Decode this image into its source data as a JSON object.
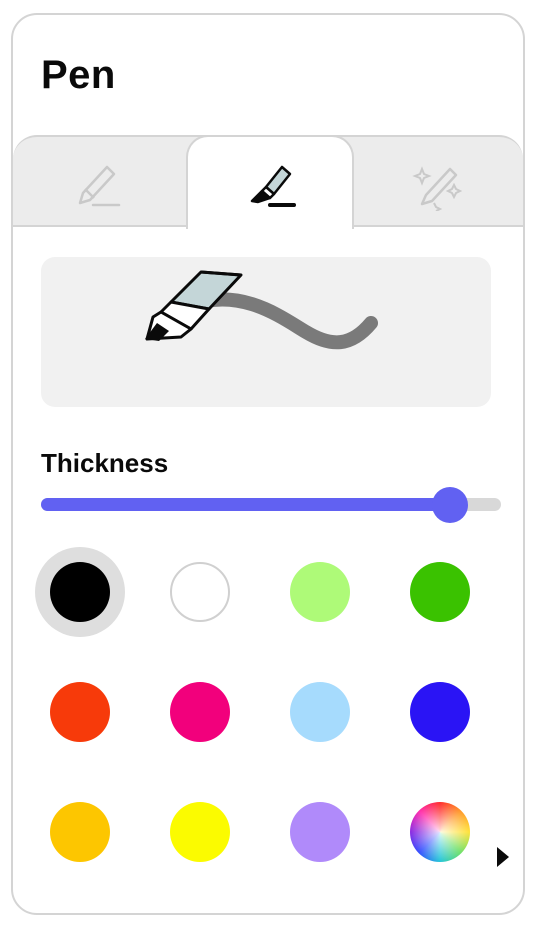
{
  "panel": {
    "title": "Pen"
  },
  "tabs": [
    {
      "name": "pen-tab",
      "icon": "pen-icon",
      "selected": false
    },
    {
      "name": "highlighter-tab",
      "icon": "highlighter-icon",
      "selected": true
    },
    {
      "name": "magic-pen-tab",
      "icon": "magic-wand-icon",
      "selected": false
    }
  ],
  "preview": {
    "tool_icon": "highlighter-icon",
    "stroke_color": "#7a7a7a"
  },
  "thickness": {
    "label": "Thickness",
    "value": 0.89
  },
  "colors": {
    "selected": "#000000",
    "swatches": [
      "#000000",
      "#ffffff",
      "#aefa78",
      "#3ac200",
      "#f73a0a",
      "#f2007c",
      "#a6dbfd",
      "#2a14f5",
      "#fdc600",
      "#fbfb00",
      "#b08afa",
      "color-wheel"
    ],
    "more_icon": "play-arrow-icon"
  },
  "accent": "#6161f2"
}
